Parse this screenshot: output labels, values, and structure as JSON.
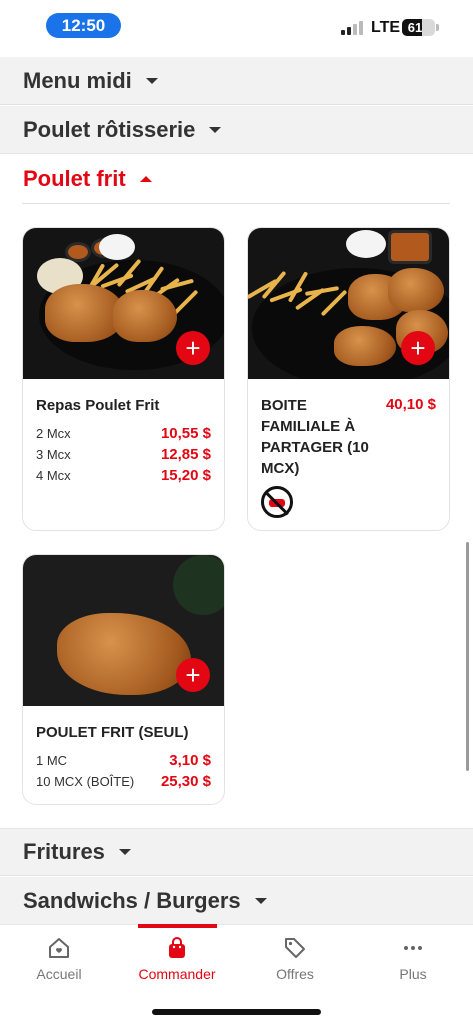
{
  "status_bar": {
    "time": "12:50",
    "network": "LTE",
    "battery": "61",
    "battery_level": 0.61
  },
  "categories": {
    "menu_midi": "Menu midi",
    "poulet_rotisserie": "Poulet rôtisserie",
    "poulet_frit": "Poulet frit",
    "fritures": "Fritures",
    "sandwichs": "Sandwichs / Burgers"
  },
  "products": [
    {
      "name": "Repas Poulet Frit",
      "options": [
        {
          "label": "2 Mcx",
          "price": "10,55 $"
        },
        {
          "label": "3 Mcx",
          "price": "12,85 $"
        },
        {
          "label": "4 Mcx",
          "price": "15,20 $"
        }
      ],
      "add_label": "+"
    },
    {
      "name_lines": [
        "BOITE",
        "FAMILIALE À",
        "PARTAGER (10",
        "MCX)"
      ],
      "price": "40,10 $",
      "badge_icon": "no-cutlery-icon",
      "add_label": "+"
    },
    {
      "name": "POULET FRIT (SEUL)",
      "options": [
        {
          "label": "1 MC",
          "price": "3,10 $"
        },
        {
          "label": "10 MCX (BOÎTE)",
          "price": "25,30 $"
        }
      ],
      "add_label": "+"
    }
  ],
  "bottom_nav": {
    "items": [
      {
        "label": "Accueil",
        "icon": "home-heart-icon"
      },
      {
        "label": "Commander",
        "icon": "shopping-bag-icon",
        "active": true
      },
      {
        "label": "Offres",
        "icon": "tag-icon"
      },
      {
        "label": "Plus",
        "icon": "more-dots-icon"
      }
    ]
  },
  "colors": {
    "accent": "#e30613",
    "time_pill": "#1a73e8"
  }
}
